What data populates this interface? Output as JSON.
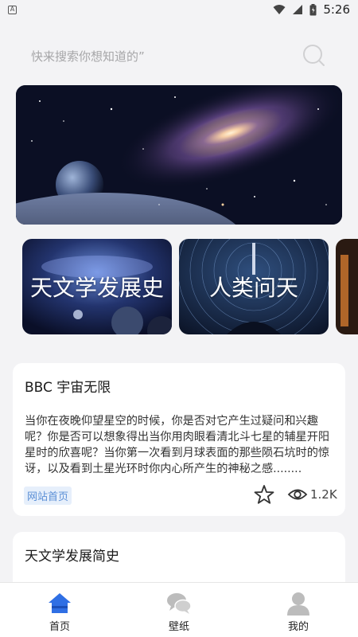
{
  "status_bar": {
    "time": "5:26",
    "left_indicator": "A"
  },
  "search": {
    "placeholder": "快来搜索你想知道的”"
  },
  "categories": [
    {
      "title": "天文学发展史"
    },
    {
      "title": "人类问天"
    }
  ],
  "posts": [
    {
      "title": "BBC 宇宙无限",
      "body": "当你在夜晚仰望星空的时候，你是否对它产生过疑问和兴趣呢？你是否可以想象得出当你用肉眼看清北斗七星的辅星开阳星时的欣喜呢？当你第一次看到月球表面的那些陨石坑时的惊讶，以及看到土星光环时你内心所产生的神秘之感........",
      "tag": "网站首页",
      "views": "1.2K"
    },
    {
      "title": "天文学发展简史"
    }
  ],
  "tabbar": {
    "items": [
      {
        "label": "首页",
        "icon": "home-icon",
        "active": true
      },
      {
        "label": "壁纸",
        "icon": "chat-bubbles-icon",
        "active": false
      },
      {
        "label": "我的",
        "icon": "user-icon",
        "active": false
      }
    ]
  },
  "colors": {
    "accent": "#2f6fe4",
    "tag_text": "#5b8fd6",
    "tag_bg": "#e6effb",
    "inactive_icon": "#bcbcbc",
    "background": "#f3f3f5"
  }
}
